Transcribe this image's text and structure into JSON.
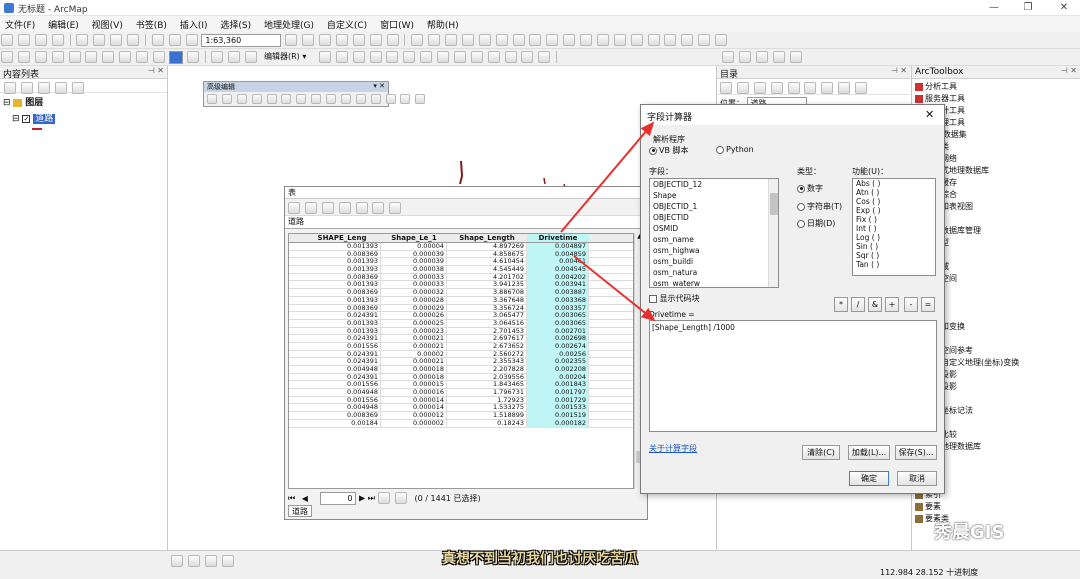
{
  "window": {
    "title": "无标题 - ArcMap",
    "minimize": "—",
    "maximize": "❐",
    "close": "✕"
  },
  "menu": [
    "文件(F)",
    "编辑(E)",
    "视图(V)",
    "书签(B)",
    "插入(I)",
    "选择(S)",
    "地理处理(G)",
    "自定义(C)",
    "窗口(W)",
    "帮助(H)"
  ],
  "toolbar": {
    "scale": "1:63,360",
    "editor_label": "编辑器(R) ▾"
  },
  "toc": {
    "title": "内容列表",
    "layers_label": "图层",
    "layer_name": "道路"
  },
  "advanced_edit": {
    "title": "高级编辑"
  },
  "table": {
    "window_title": "表",
    "layer_tab": "道路",
    "columns": [
      "SHAPE_Leng",
      "Shape_Le_1",
      "Shape_Length",
      "Drivetime"
    ],
    "rows": [
      [
        "0.001393",
        "0.00004",
        "4.897269",
        "0.004897"
      ],
      [
        "0.008369",
        "0.000039",
        "4.858675",
        "0.004859"
      ],
      [
        "0.001393",
        "0.000039",
        "4.610454",
        "0.00461"
      ],
      [
        "0.001393",
        "0.000038",
        "4.545449",
        "0.004545"
      ],
      [
        "0.008369",
        "0.000033",
        "4.201702",
        "0.004202"
      ],
      [
        "0.001393",
        "0.000033",
        "3.941235",
        "0.003941"
      ],
      [
        "0.008369",
        "0.000032",
        "3.886708",
        "0.003887"
      ],
      [
        "0.001393",
        "0.000028",
        "3.367648",
        "0.003368"
      ],
      [
        "0.008369",
        "0.000029",
        "3.356724",
        "0.003357"
      ],
      [
        "0.024391",
        "0.000026",
        "3.065477",
        "0.003065"
      ],
      [
        "0.001393",
        "0.000025",
        "3.064516",
        "0.003065"
      ],
      [
        "0.001393",
        "0.000023",
        "2.701453",
        "0.002701"
      ],
      [
        "0.024391",
        "0.000021",
        "2.697617",
        "0.002698"
      ],
      [
        "0.001556",
        "0.000021",
        "2.673652",
        "0.002674"
      ],
      [
        "0.024391",
        "0.00002",
        "2.560272",
        "0.00256"
      ],
      [
        "0.024391",
        "0.000021",
        "2.355343",
        "0.002355"
      ],
      [
        "0.004948",
        "0.000018",
        "2.207828",
        "0.002208"
      ],
      [
        "0.024391",
        "0.000018",
        "2.039556",
        "0.00204"
      ],
      [
        "0.001556",
        "0.000015",
        "1.843465",
        "0.001843"
      ],
      [
        "0.004948",
        "0.000016",
        "1.796731",
        "0.001797"
      ],
      [
        "0.001556",
        "0.000014",
        "1.72923",
        "0.001729"
      ],
      [
        "0.004948",
        "0.000014",
        "1.533275",
        "0.001533"
      ],
      [
        "0.008369",
        "0.000012",
        "1.518899",
        "0.001519"
      ],
      [
        "0.00184",
        "0.000002",
        "0.18243",
        "0.000182"
      ]
    ],
    "record_value": "0",
    "selection_status": "(0 / 1441 已选择)",
    "bottom_tab": "道路"
  },
  "catalog": {
    "title": "目录",
    "location_label": "位置：",
    "location_value": "道路"
  },
  "toolbox": {
    "title": "ArcToolbox",
    "items": [
      "分析工具",
      "服务器工具",
      "间统计工具",
      "据管理工具",
      "LAS 数据集",
      "关系类",
      "几何网络",
      "分布式地理数据库",
      "切片缓存",
      "制图综合",
      "图层和表视图",
      "图表",
      "地理数据库管理",
      "子类型",
      "字段",
      "属性域",
      "工作空间",
      "常规",
      "归档",
      "打包",
      "投影和变换",
      "栅格",
      "创建空间参考",
      "创建自定义地理(坐标)变换",
      "定义投影",
      "批量投影",
      "投影",
      "转换坐标记法",
      "拓扑",
      "数据比较",
      "文件地理数据库",
      "栅格",
      "照片",
      "版本",
      "索引",
      "要素",
      "要素类"
    ]
  },
  "dialog": {
    "title": "字段计算器",
    "parser_label": "解析程序",
    "vb_label": "VB 脚本",
    "python_label": "Python",
    "fields_label": "字段：",
    "fields": [
      "OBJECTID_12",
      "Shape",
      "OBJECTID_1",
      "OBJECTID",
      "OSMID",
      "osm_name",
      "osm_highwa",
      "osm_buildi",
      "osm_natura",
      "osm_waterw"
    ],
    "type_label": "类型：",
    "types": [
      "数字",
      "字符串(T)",
      "日期(D)"
    ],
    "functions_label": "功能(U)：",
    "functions": [
      "Abs ( )",
      "Atn ( )",
      "Cos ( )",
      "Exp ( )",
      "Fix ( )",
      "Int ( )",
      "Log ( )",
      "Sin ( )",
      "Sqr ( )",
      "Tan ( )"
    ],
    "show_codeblock": "显示代码块",
    "operators": [
      "*",
      "/",
      "&",
      "+",
      "-",
      "="
    ],
    "expression_label": "Drivetime =",
    "expression": "[Shape_Length] /1000",
    "help_link": "关于计算字段",
    "clear": "清除(C)",
    "load": "加载(L)...",
    "save": "保存(S)...",
    "ok": "确定",
    "cancel": "取消"
  },
  "status": {
    "coords": "112.984  28.152 十进制度"
  },
  "subtitle": "真想不到当初我们也讨厌吃苦瓜",
  "watermark": "秀晨GIS"
}
